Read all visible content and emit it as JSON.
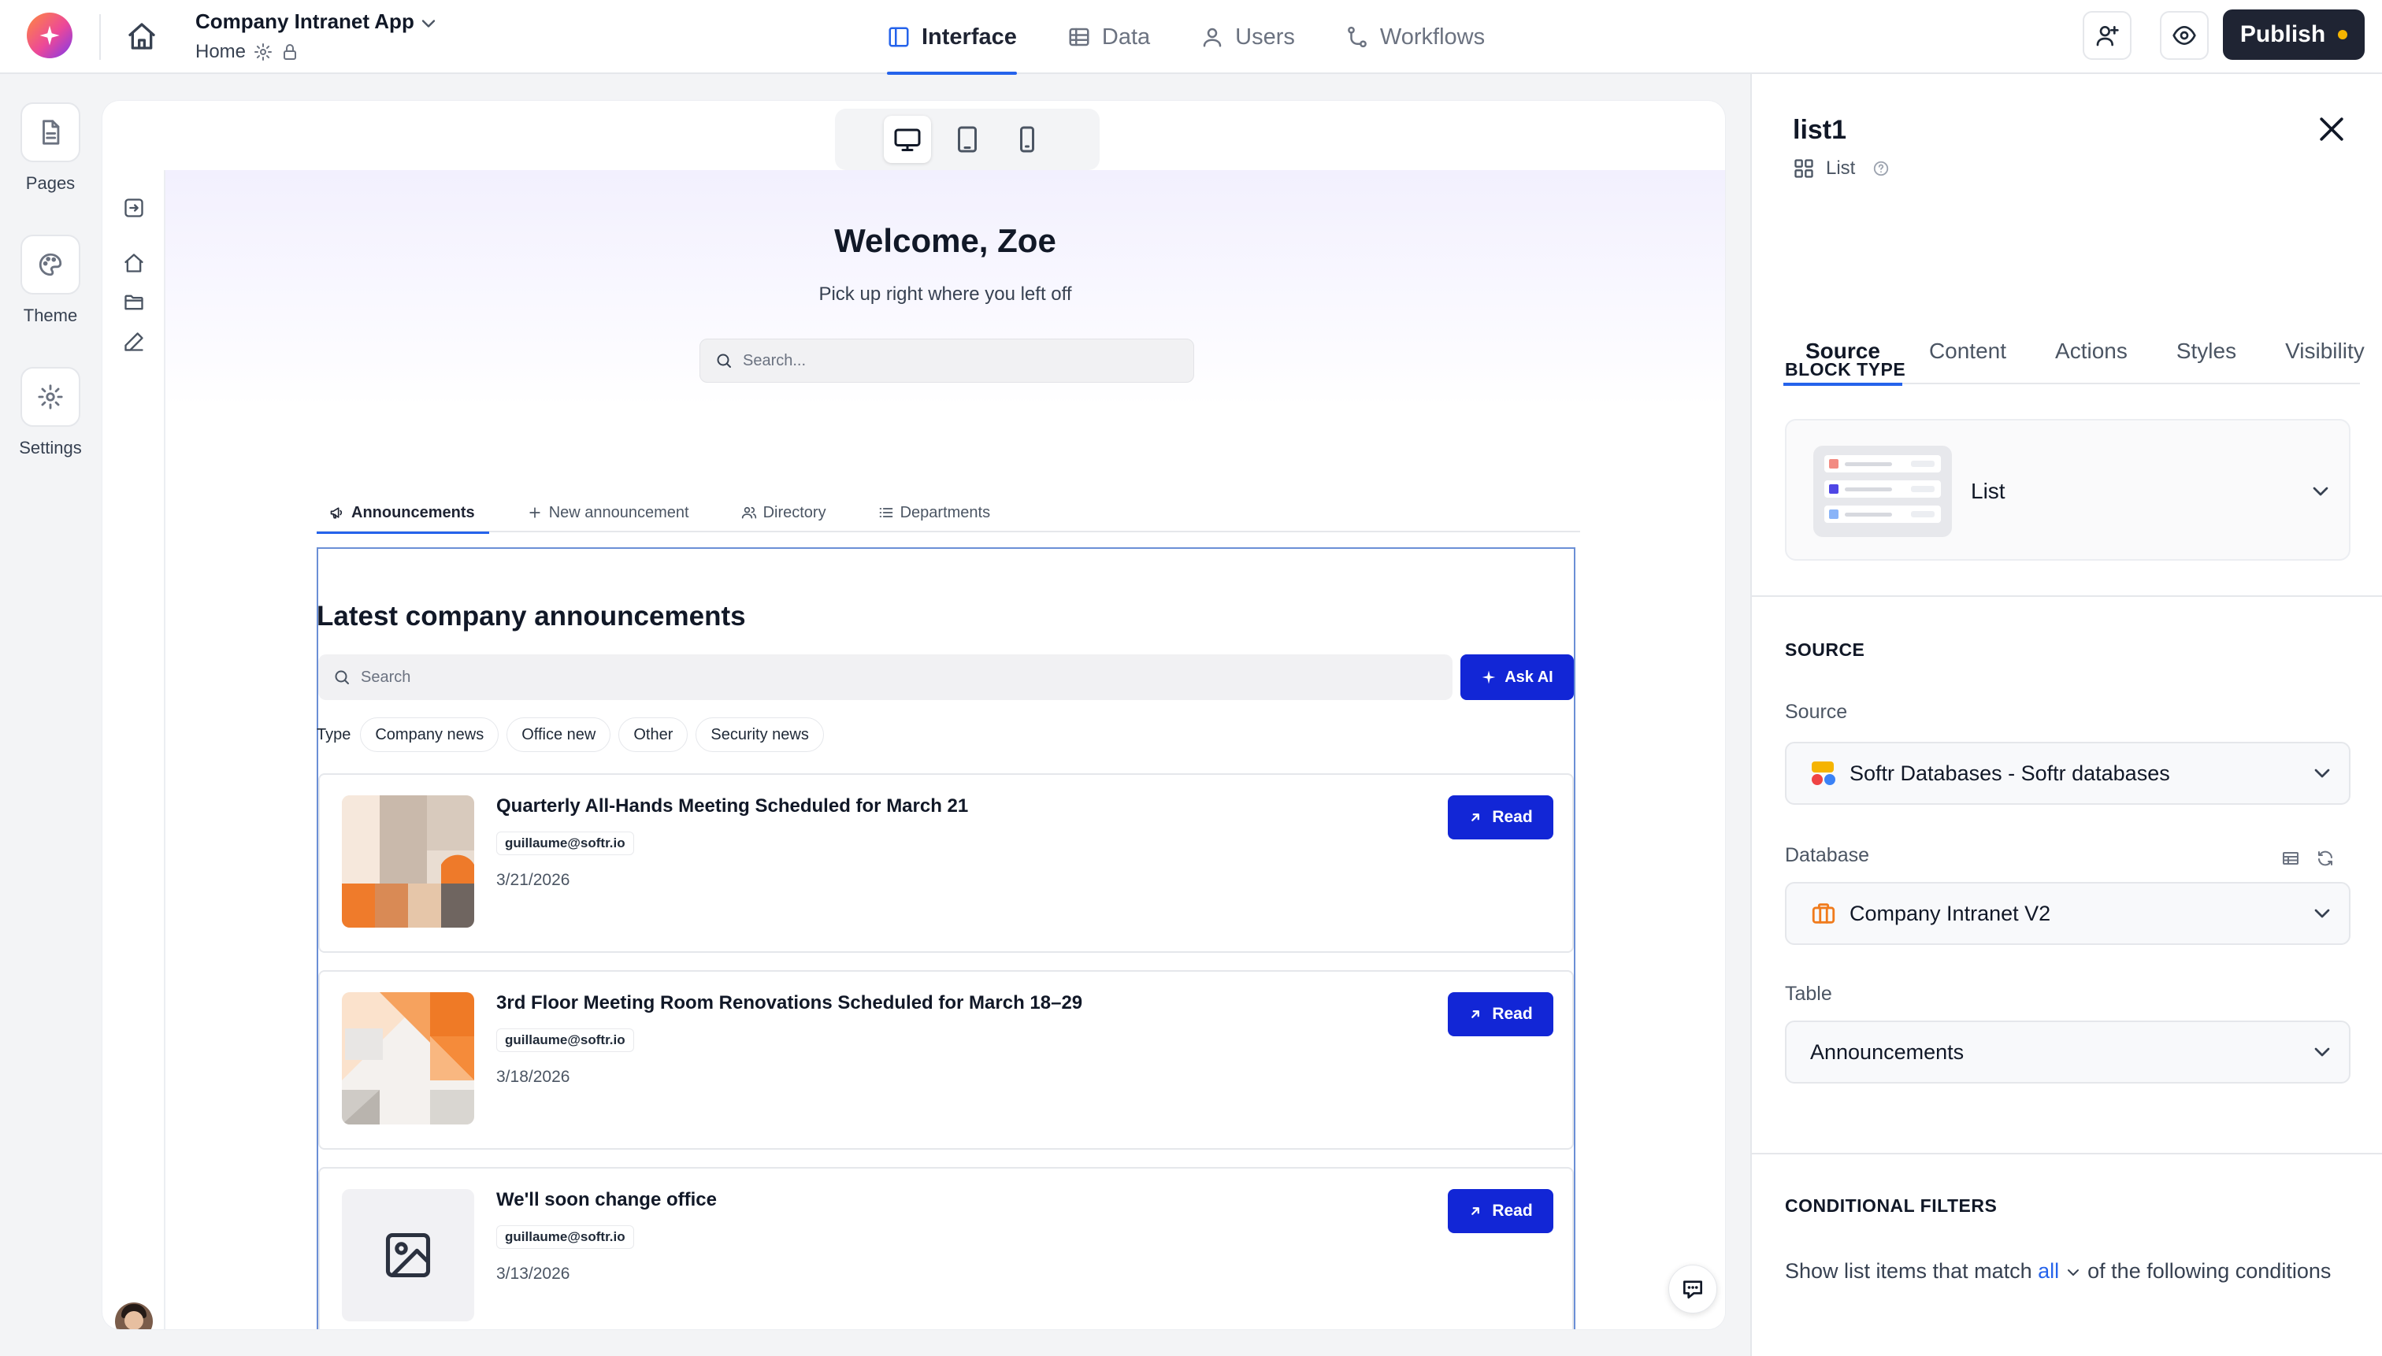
{
  "app": {
    "title": "Company Intranet App",
    "breadcrumb": "Home"
  },
  "nav": {
    "tabs": [
      {
        "label": "Interface",
        "icon": "layout-icon",
        "active": true
      },
      {
        "label": "Data",
        "icon": "table-icon",
        "active": false
      },
      {
        "label": "Users",
        "icon": "user-icon",
        "active": false
      },
      {
        "label": "Workflows",
        "icon": "workflow-icon",
        "active": false
      }
    ]
  },
  "actions": {
    "publish_label": "Publish",
    "publish_dot_color": "#f5b400"
  },
  "rail": {
    "pages_label": "Pages",
    "theme_label": "Theme",
    "settings_label": "Settings"
  },
  "page": {
    "welcome": "Welcome, Zoe",
    "subtitle": "Pick up right where you left off",
    "search_placeholder": "Search...",
    "subnav": [
      {
        "label": "Announcements",
        "icon": "megaphone-icon",
        "active": true
      },
      {
        "label": "New announcement",
        "icon": "plus-icon",
        "active": false
      },
      {
        "label": "Directory",
        "icon": "users-icon",
        "active": false
      },
      {
        "label": "Departments",
        "icon": "list-icon",
        "active": false
      }
    ],
    "list": {
      "heading": "Latest company announcements",
      "search_placeholder": "Search",
      "ask_ai_label": "Ask AI",
      "filter_label": "Type",
      "filters": [
        "Company news",
        "Office new",
        "Other",
        "Security news"
      ],
      "items": [
        {
          "title": "Quarterly All-Hands Meeting Scheduled for March 21",
          "author": "guillaume@softr.io",
          "date": "3/21/2026",
          "read_label": "Read",
          "thumb": "geometric-orange"
        },
        {
          "title": "3rd Floor Meeting Room Renovations Scheduled for March 18–29",
          "author": "guillaume@softr.io",
          "date": "3/18/2026",
          "read_label": "Read",
          "thumb": "geometric-diagonal"
        },
        {
          "title": "We'll soon change office",
          "author": "guillaume@softr.io",
          "date": "3/13/2026",
          "read_label": "Read",
          "thumb": "image-placeholder"
        }
      ]
    }
  },
  "panel": {
    "block_name": "list1",
    "block_kind": "List",
    "tabs": [
      {
        "label": "Source",
        "active": true
      },
      {
        "label": "Content",
        "active": false
      },
      {
        "label": "Actions",
        "active": false
      },
      {
        "label": "Styles",
        "active": false
      },
      {
        "label": "Visibility",
        "active": false
      }
    ],
    "block_type_heading": "BLOCK TYPE",
    "block_type_value": "List",
    "source_heading": "SOURCE",
    "source_label": "Source",
    "source_value": "Softr Databases - Softr databases",
    "database_label": "Database",
    "database_value": "Company Intranet V2",
    "table_label": "Table",
    "table_value": "Announcements",
    "cond_heading": "CONDITIONAL FILTERS",
    "cond_pre": "Show list items that match",
    "cond_match": "all",
    "cond_post": "of the following conditions"
  },
  "colors": {
    "accent": "#2563eb",
    "primary_button": "#1226d6",
    "publish_bg": "#1f2433"
  }
}
